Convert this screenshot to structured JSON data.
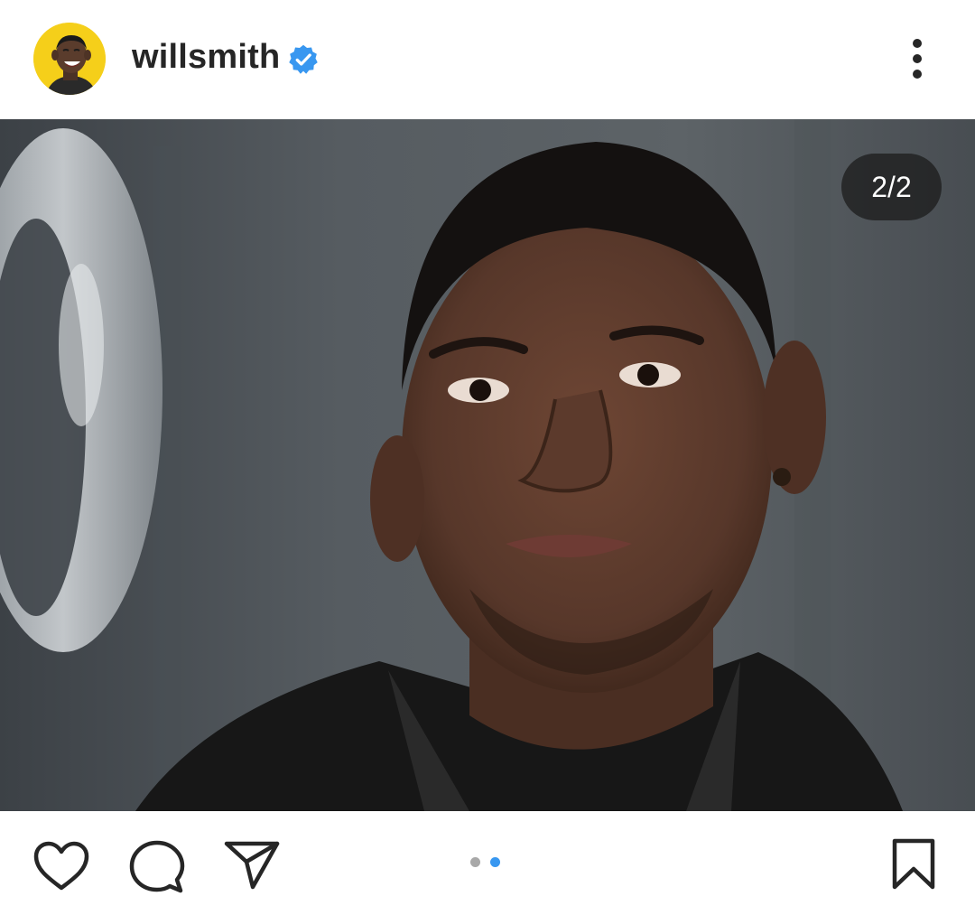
{
  "post": {
    "username": "willsmith",
    "verified": true,
    "image_counter": "2/2",
    "carousel": {
      "total": 2,
      "active_index": 2
    }
  },
  "icons": {
    "verified": "verified-badge-icon",
    "more": "more-vertical-icon",
    "like": "heart-icon",
    "comment": "comment-bubble-icon",
    "share": "paper-plane-icon",
    "save": "bookmark-icon"
  },
  "colors": {
    "text": "#262626",
    "verified": "#3897f0",
    "dot_active": "#3897f0",
    "dot_inactive": "#a8a8a8",
    "avatar_ring": "#f5cf1a"
  }
}
